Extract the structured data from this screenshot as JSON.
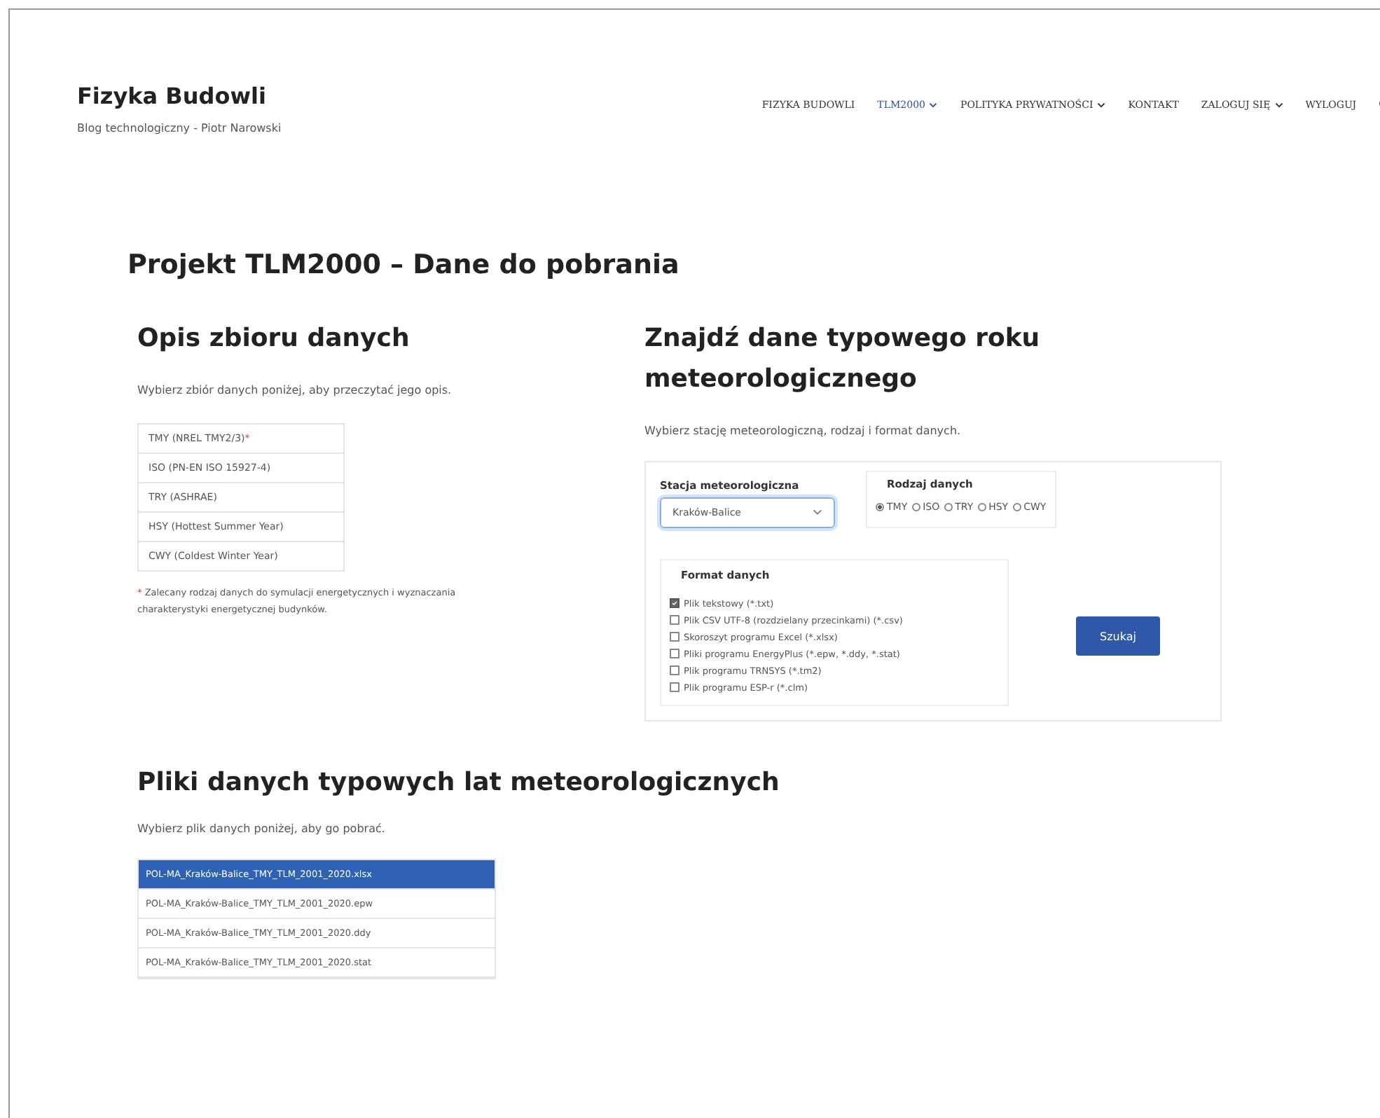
{
  "site": {
    "title": "Fizyka Budowli",
    "tagline": "Blog technologiczny - Piotr Narowski"
  },
  "nav": [
    {
      "label": "FIZYKA BUDOWLI",
      "selected": false,
      "dropdown": false
    },
    {
      "label": "TLM2000",
      "selected": true,
      "dropdown": true
    },
    {
      "label": "POLITYKA PRYWATNOŚCI",
      "selected": false,
      "dropdown": true
    },
    {
      "label": "KONTAKT",
      "selected": false,
      "dropdown": false
    },
    {
      "label": "ZALOGUJ SIĘ",
      "selected": false,
      "dropdown": true
    },
    {
      "label": "WYLOGUJ",
      "selected": false,
      "dropdown": false
    }
  ],
  "page_title": "Projekt TLM2000 – Dane do pobrania",
  "description": {
    "heading": "Opis zbioru danych",
    "intro": "Wybierz zbiór danych poniżej, aby przeczytać jego opis.",
    "datasets": [
      {
        "label": "TMY (NREL TMY2/3)",
        "mark": "*"
      },
      {
        "label": "ISO (PN-EN ISO 15927-4)"
      },
      {
        "label": "TRY (ASHRAE)"
      },
      {
        "label": "HSY (Hottest Summer Year)"
      },
      {
        "label": "CWY (Coldest Winter Year)"
      }
    ],
    "footnote_mark": "*",
    "footnote": "Zalecany rodzaj danych do symulacji energetycznych i wyznaczania charakterystyki energetycznej budynków."
  },
  "search": {
    "heading": "Znajdź dane typowego roku meteorologicznego",
    "intro": "Wybierz stację meteorologiczną, rodzaj i format danych.",
    "station": {
      "label": "Stacja meteorologiczna",
      "value": "Kraków-Balice"
    },
    "data_type": {
      "label": "Rodzaj danych",
      "options": [
        {
          "label": "TMY",
          "selected": true
        },
        {
          "label": "ISO",
          "selected": false
        },
        {
          "label": "TRY",
          "selected": false
        },
        {
          "label": "HSY",
          "selected": false
        },
        {
          "label": "CWY",
          "selected": false
        }
      ]
    },
    "format": {
      "label": "Format danych",
      "options": [
        {
          "label": "Plik tekstowy (*.txt)",
          "checked": true
        },
        {
          "label": "Plik CSV UTF-8 (rozdzielany przecinkami) (*.csv)",
          "checked": false
        },
        {
          "label": "Skoroszyt programu Excel (*.xlsx)",
          "checked": false
        },
        {
          "label": "Pliki programu EnergyPlus (*.epw, *.ddy, *.stat)",
          "checked": false
        },
        {
          "label": "Plik programu TRNSYS (*.tm2)",
          "checked": false
        },
        {
          "label": "Plik programu ESP-r (*.clm)",
          "checked": false
        }
      ]
    },
    "button": "Szukaj"
  },
  "files": {
    "heading": "Pliki danych typowych lat meteorologicznych",
    "intro": "Wybierz plik danych poniżej, aby go pobrać.",
    "items": [
      {
        "label": "POL-MA_Kraków-Balice_TMY_TLM_2001_2020.xlsx",
        "selected": true
      },
      {
        "label": "POL-MA_Kraków-Balice_TMY_TLM_2001_2020.epw",
        "selected": false
      },
      {
        "label": "POL-MA_Kraków-Balice_TMY_TLM_2001_2020.ddy",
        "selected": false
      },
      {
        "label": "POL-MA_Kraków-Balice_TMY_TLM_2001_2020.stat",
        "selected": false
      }
    ]
  }
}
